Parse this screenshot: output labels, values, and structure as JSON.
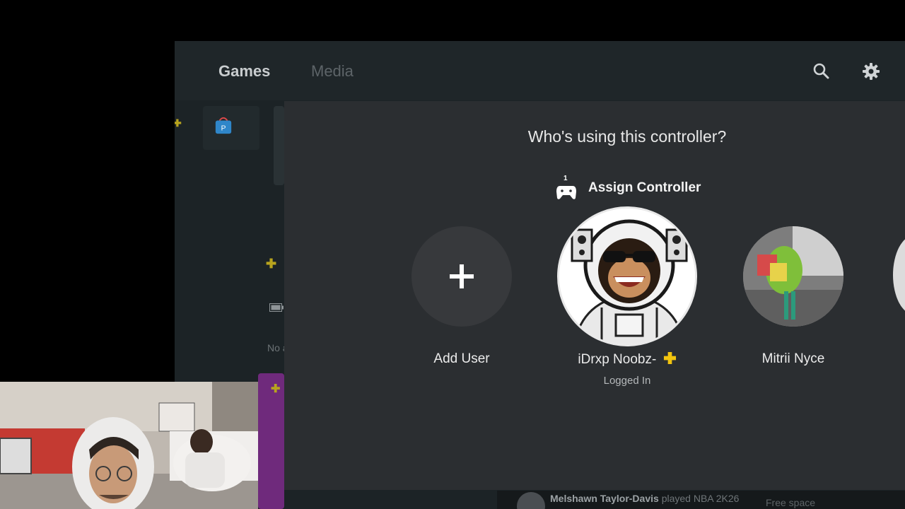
{
  "home": {
    "tabs": [
      {
        "label": "Games",
        "active": true
      },
      {
        "label": "Media",
        "active": false
      }
    ],
    "side_text": "No a",
    "activity": {
      "user": "Melshawn Taylor-Davis",
      "action": "played NBA 2K26",
      "free_space_label": "Free space"
    }
  },
  "dialog": {
    "title": "Who's using this controller?",
    "assign_label": "Assign Controller",
    "controller_number": "1",
    "users": [
      {
        "name": "Add User",
        "status": ""
      },
      {
        "name": "iDrxp Noobz-",
        "status": "Logged In",
        "plus": true
      },
      {
        "name": "Mitrii Nyce",
        "status": ""
      }
    ]
  },
  "colors": {
    "plus_badge": "#f2c40f",
    "overlay_bg": "#2b2e31",
    "home_bg": "#1c2326"
  },
  "icons": {
    "search": "search-icon",
    "settings": "gear-icon",
    "controller": "controller-icon",
    "add": "plus-icon",
    "playstation_plus": "playstation-plus-icon"
  }
}
